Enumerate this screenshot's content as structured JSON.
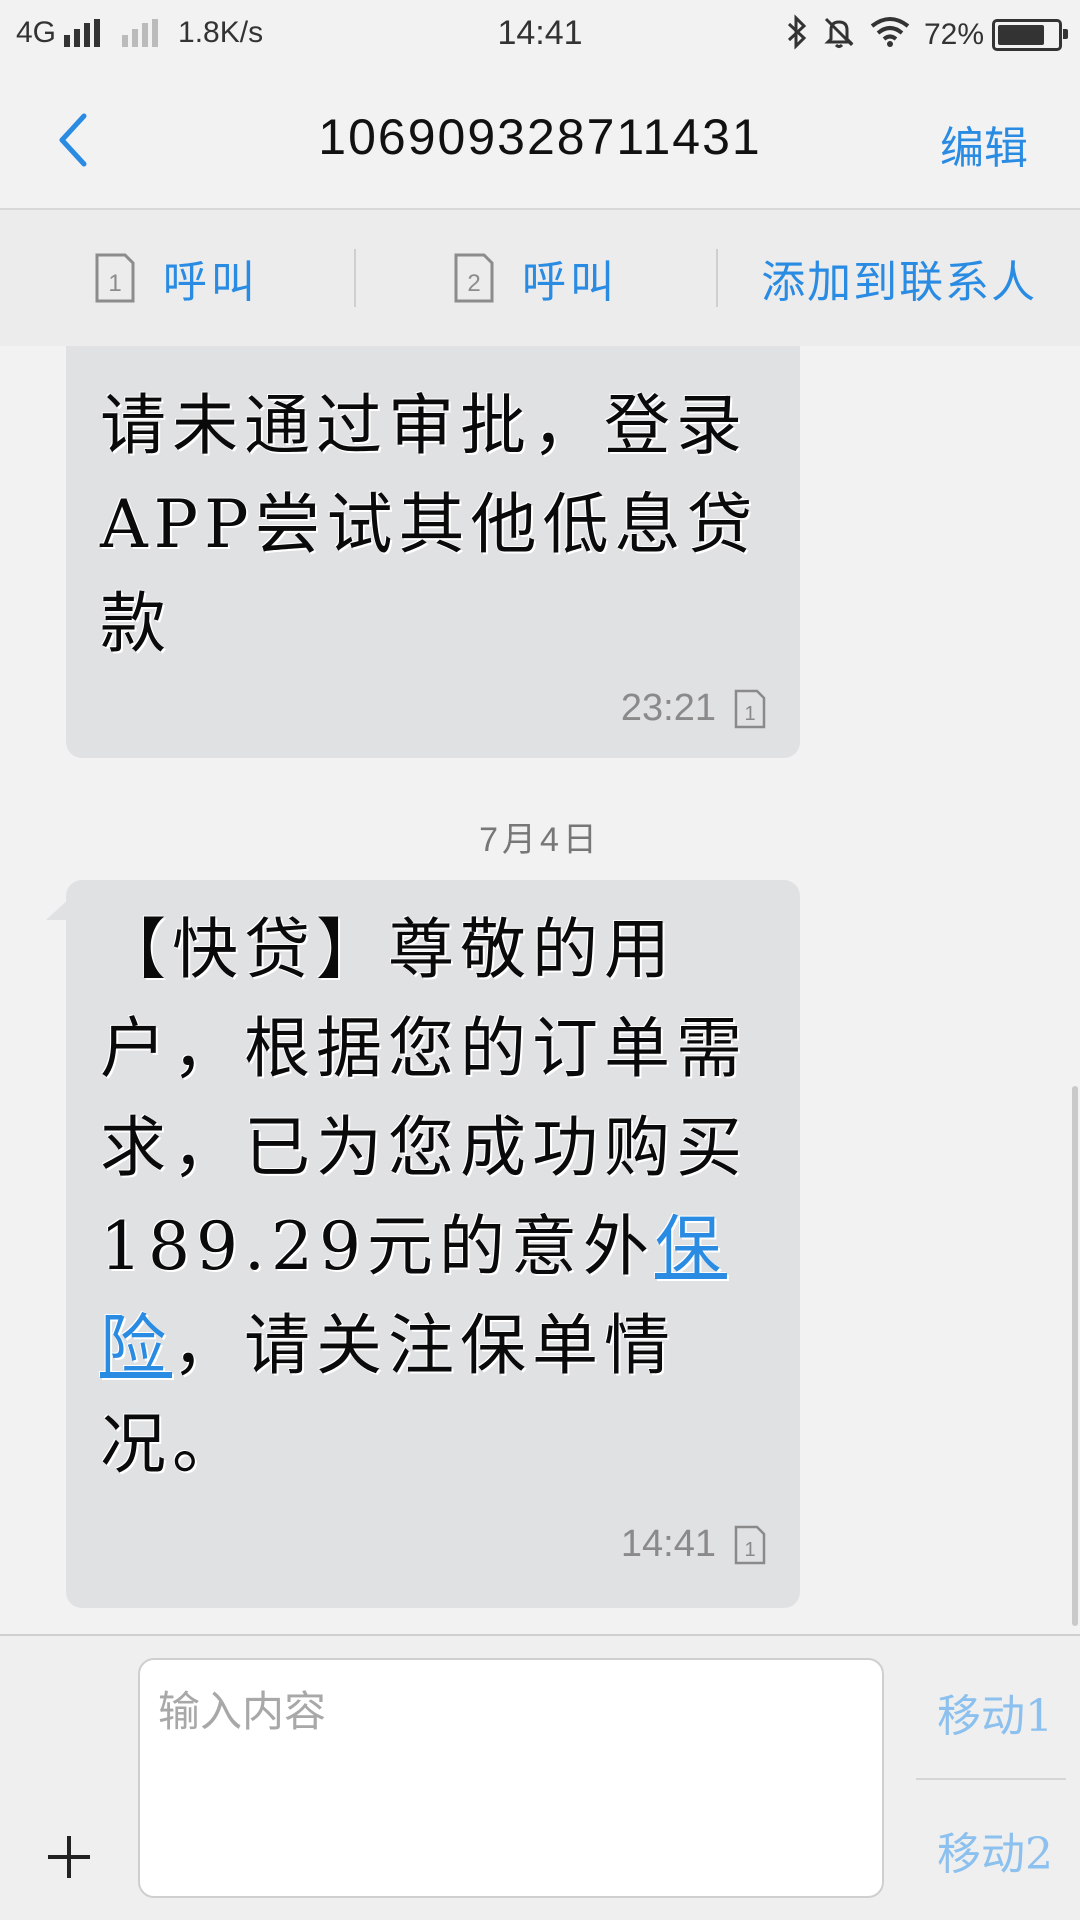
{
  "status_bar": {
    "network": "4G",
    "speed": "1.8K/s",
    "time": "14:41",
    "battery": "72%",
    "battery_level": 0.72,
    "icons": [
      "signal-icon",
      "signal-sim2-icon",
      "bluetooth-icon",
      "mute-icon",
      "wifi-icon",
      "battery-icon"
    ]
  },
  "header": {
    "back_icon": "back-arrow-icon",
    "title": "106909328711431",
    "edit_label": "编辑"
  },
  "actions": {
    "call1_sim": "1",
    "call1_label": "呼叫",
    "call2_sim": "2",
    "call2_label": "呼叫",
    "add_contact_label": "添加到联系人"
  },
  "messages": [
    {
      "text": "请未通过审批，登录APP尝试其他低息贷款",
      "time": "23:21",
      "sim": "1"
    },
    {
      "text_before": "【快贷】尊敬的用户，根据您的订单需求，已为您成功购买189.29元的意外",
      "link": "保险",
      "text_after": "，请关注保单情况。",
      "time": "14:41",
      "sim": "1"
    }
  ],
  "date_separator": "7月4日",
  "composer": {
    "placeholder": "输入内容",
    "send1_label": "移动1",
    "send2_label": "移动2",
    "plus_icon": "plus-icon"
  },
  "colors": {
    "accent": "#2a8be3",
    "bubble": "#dfe1e3",
    "background": "#f2f2f2",
    "send_disabled": "#8cc0ee"
  }
}
